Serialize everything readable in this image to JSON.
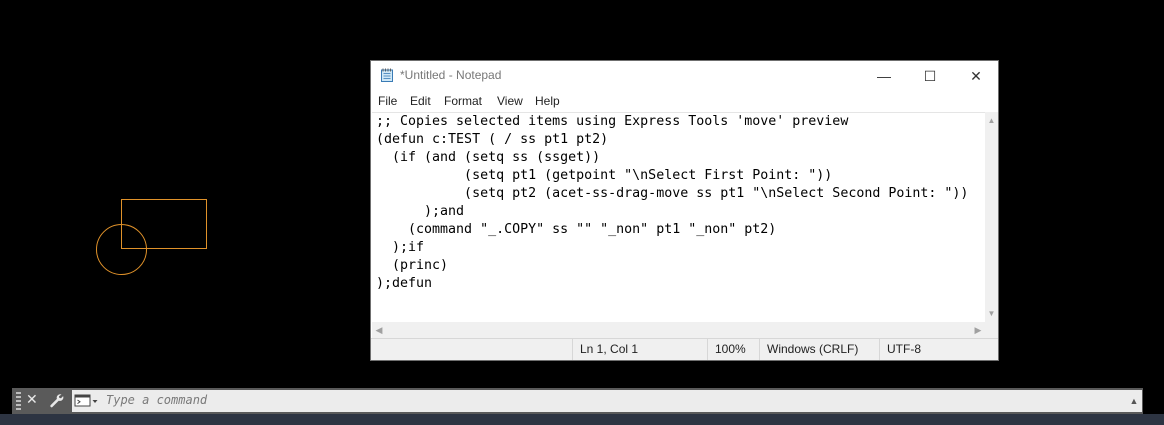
{
  "notepad": {
    "title": "*Untitled - Notepad",
    "controls": {
      "minimize": "—",
      "maximize": "☐",
      "close": "✕"
    },
    "menu": [
      "File",
      "Edit",
      "Format",
      "View",
      "Help"
    ],
    "lines": [
      ";; Copies selected items using Express Tools 'move' preview",
      "(defun c:TEST ( / ss pt1 pt2)",
      "  (if (and (setq ss (ssget))",
      "           (setq pt1 (getpoint \"\\nSelect First Point: \"))",
      "           (setq pt2 (acet-ss-drag-move ss pt1 \"\\nSelect Second Point: \"))",
      "      );and",
      "    (command \"_.COPY\" ss \"\" \"_non\" pt1 \"_non\" pt2)",
      "  );if",
      "  (princ)",
      ");defun"
    ],
    "status": {
      "position": "Ln 1, Col 1",
      "zoom": "100%",
      "line_ending": "Windows (CRLF)",
      "encoding": "UTF-8"
    }
  },
  "cad": {
    "stroke_color": "#e0922a"
  },
  "command_line": {
    "close": "✕",
    "placeholder": "Type a command"
  }
}
